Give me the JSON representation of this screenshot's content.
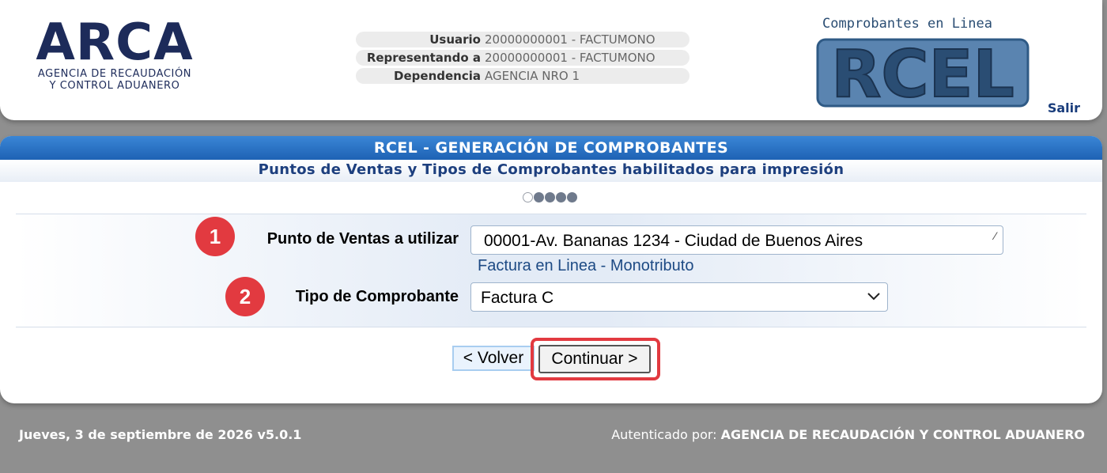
{
  "header": {
    "brand": {
      "name": "ARCA",
      "subtitle_line1": "AGENCIA DE RECAUDACIÓN",
      "subtitle_line2": "Y CONTROL ADUANERO"
    },
    "user_info": [
      {
        "label": "Usuario",
        "value": "20000000001 - FACTUMONO"
      },
      {
        "label": "Representando a",
        "value": "20000000001 - FACTUMONO"
      },
      {
        "label": "Dependencia",
        "value": "AGENCIA NRO 1"
      }
    ],
    "rcel_logo": {
      "caption": "Comprobantes en Linea",
      "word": "RCEL"
    },
    "logout_label": "Salir"
  },
  "main": {
    "title": "RCEL - GENERACIÓN DE COMPROBANTES",
    "subtitle": "Puntos de Ventas y Tipos de Comprobantes habilitados para impresión",
    "steps": {
      "total": 5,
      "current": 1
    },
    "fields": {
      "punto_venta": {
        "badge": "1",
        "label": "Punto de Ventas a utilizar",
        "value": "00001-Av. Bananas 1234 - Ciudad de Buenos Aires",
        "hint": "Factura en Linea - Monotributo"
      },
      "tipo_comprobante": {
        "badge": "2",
        "label": "Tipo de Comprobante",
        "value": "Factura C"
      }
    },
    "buttons": {
      "back_label": "< Volver",
      "continue_label": "Continuar >"
    }
  },
  "footer": {
    "date_version": "Jueves, 3 de septiembre de 2026 v5.0.1",
    "auth_prefix": "Autenticado por:",
    "auth_entity": "AGENCIA DE RECAUDACIÓN Y CONTROL ADUANERO"
  },
  "colors": {
    "brand_navy": "#1d2b5a",
    "title_bar_blue": "#1e62b4",
    "highlight_red": "#e23a40",
    "page_gray": "#8f8f8f"
  }
}
